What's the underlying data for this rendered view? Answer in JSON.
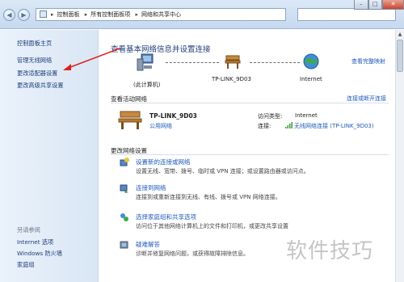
{
  "breadcrumb": {
    "items": [
      "控制面板",
      "所有控制面板项",
      "网络和共享中心"
    ]
  },
  "window_controls": {
    "minimize": "–",
    "maximize": "□",
    "close": "✕"
  },
  "nav": {
    "back": "◀",
    "forward": "▶"
  },
  "sidebar": {
    "home": "控制面板主页",
    "items": [
      "管理无线网络",
      "更改适配器设置",
      "更改高级共享设置"
    ],
    "see_also_title": "另请参阅",
    "see_also": [
      "Internet 选项",
      "Windows 防火墙",
      "家庭组"
    ]
  },
  "main": {
    "title": "查看基本网络信息并设置连接",
    "view_map": "查看完整映射",
    "map": {
      "computer": "(此计算机)",
      "network": "TP-LINK_9D03",
      "internet": "Internet"
    },
    "active_section": "查看活动网络",
    "connect_disconnect": "连接或断开连接",
    "active": {
      "name": "TP-LINK_9D03",
      "type": "公用网络",
      "access_label": "访问类型:",
      "access_value": "Internet",
      "conn_label": "连接:",
      "conn_value": "无线网络连接 (TP-LINK_9D03)"
    },
    "change_section": "更改网络设置",
    "tasks": [
      {
        "title": "设置新的连接或网络",
        "desc": "设置无线、宽带、拨号、临时或 VPN 连接；或设置路由器或访问点。"
      },
      {
        "title": "连接到网络",
        "desc": "连接到或重新连接到无线、有线、拨号或 VPN 网络连接。"
      },
      {
        "title": "选择家庭组和共享选项",
        "desc": "访问位于其他网络计算机上的文件和打印机，或更改共享设置"
      },
      {
        "title": "疑难解答",
        "desc": "诊断并修复网络问题，或获得故障排除信息。"
      }
    ]
  },
  "watermark": "软件技巧",
  "colors": {
    "accent": "#1f5ab8",
    "arrow": "#e02020",
    "sidebar_bg": "#dde9f6"
  }
}
